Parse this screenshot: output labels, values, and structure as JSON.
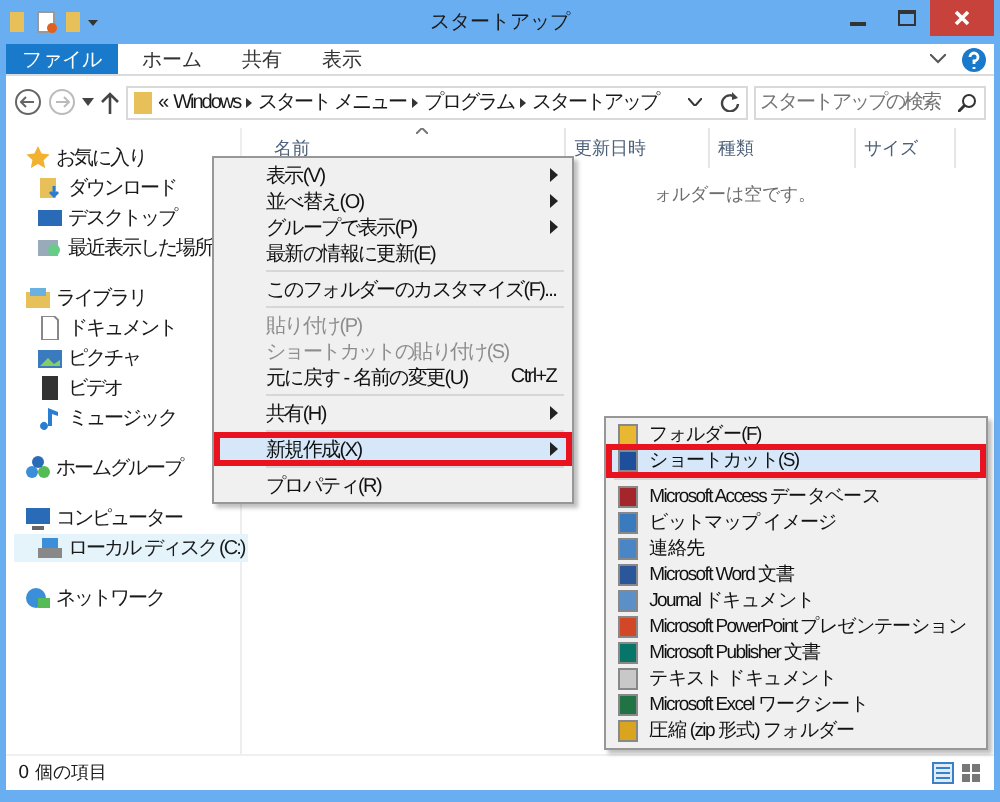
{
  "window": {
    "title": "スタートアップ"
  },
  "ribbon": {
    "tabs": [
      {
        "label": "ファイル",
        "selected": true
      },
      {
        "label": "ホーム",
        "selected": false
      },
      {
        "label": "共有",
        "selected": false
      },
      {
        "label": "表示",
        "selected": false
      }
    ]
  },
  "address_bar": {
    "segments": [
      "«",
      "Windows",
      "スタート メニュー",
      "プログラム",
      "スタートアップ"
    ],
    "search": {
      "placeholder": "スタートアップの検索"
    }
  },
  "navigation": [
    {
      "label": "お気に入り",
      "children": [
        {
          "label": "ダウンロード",
          "selected": false
        },
        {
          "label": "デスクトップ",
          "selected": false
        },
        {
          "label": "最近表示した場所",
          "selected": false
        }
      ]
    },
    {
      "label": "ライブラリ",
      "children": [
        {
          "label": "ドキュメント",
          "selected": false
        },
        {
          "label": "ピクチャ",
          "selected": false
        },
        {
          "label": "ビデオ",
          "selected": false
        },
        {
          "label": "ミュージック",
          "selected": false
        }
      ]
    },
    {
      "label": "ホームグループ"
    },
    {
      "label": "コンピューター",
      "children": [
        {
          "label": "ローカル ディスク (C:)",
          "selected": true
        }
      ]
    },
    {
      "label": "ネットワーク"
    }
  ],
  "columns": [
    {
      "label": "名前",
      "sorted": true
    },
    {
      "label": "更新日時",
      "sorted": false
    },
    {
      "label": "種類",
      "sorted": false
    },
    {
      "label": "サイズ",
      "sorted": false
    }
  ],
  "empty_message": "ォルダーは空です。",
  "context_menu": [
    {
      "kind": "item",
      "label": "表示(V)",
      "submenu": true,
      "disabled": false,
      "highlighted": false
    },
    {
      "kind": "item",
      "label": "並べ替え(O)",
      "submenu": true,
      "disabled": false,
      "highlighted": false
    },
    {
      "kind": "item",
      "label": "グループで表示(P)",
      "submenu": true,
      "disabled": false,
      "highlighted": false
    },
    {
      "kind": "item",
      "label": "最新の情報に更新(E)",
      "submenu": false,
      "disabled": false,
      "highlighted": false
    },
    {
      "kind": "separator"
    },
    {
      "kind": "item",
      "label": "このフォルダーのカスタマイズ(F)...",
      "submenu": false,
      "disabled": false,
      "highlighted": false
    },
    {
      "kind": "separator"
    },
    {
      "kind": "item",
      "label": "貼り付け(P)",
      "submenu": false,
      "disabled": true,
      "highlighted": false
    },
    {
      "kind": "item",
      "label": "ショートカットの貼り付け(S)",
      "submenu": false,
      "disabled": true,
      "highlighted": false
    },
    {
      "kind": "item",
      "label": "元に戻す - 名前の変更(U)",
      "shortcut": "Ctrl+Z",
      "submenu": false,
      "disabled": false,
      "highlighted": false
    },
    {
      "kind": "separator"
    },
    {
      "kind": "item",
      "label": "共有(H)",
      "submenu": true,
      "disabled": false,
      "highlighted": false
    },
    {
      "kind": "separator"
    },
    {
      "kind": "item",
      "label": "新規作成(X)",
      "submenu": true,
      "disabled": false,
      "highlighted": true
    },
    {
      "kind": "separator"
    },
    {
      "kind": "item",
      "label": "プロパティ(R)",
      "submenu": false,
      "disabled": false,
      "highlighted": false
    }
  ],
  "new_submenu": [
    {
      "kind": "item",
      "label": "フォルダー(F)",
      "color": "#e8b830",
      "highlighted": false
    },
    {
      "kind": "item",
      "label": "ショートカット(S)",
      "color": "#1d4f9c",
      "highlighted": true
    },
    {
      "kind": "separator"
    },
    {
      "kind": "item",
      "label": "Microsoft Access データベース",
      "color": "#a4262c",
      "highlighted": false
    },
    {
      "kind": "item",
      "label": "ビットマップ イメージ",
      "color": "#3a7bbf",
      "highlighted": false
    },
    {
      "kind": "item",
      "label": "連絡先",
      "color": "#4a86c5",
      "highlighted": false
    },
    {
      "kind": "item",
      "label": "Microsoft Word 文書",
      "color": "#2b579a",
      "highlighted": false
    },
    {
      "kind": "item",
      "label": "Journal ドキュメント",
      "color": "#5a8fc8",
      "highlighted": false
    },
    {
      "kind": "item",
      "label": "Microsoft PowerPoint プレゼンテーション",
      "color": "#d24726",
      "highlighted": false
    },
    {
      "kind": "item",
      "label": "Microsoft Publisher 文書",
      "color": "#077568",
      "highlighted": false
    },
    {
      "kind": "item",
      "label": "テキスト ドキュメント",
      "color": "#c8c8c8",
      "highlighted": false
    },
    {
      "kind": "item",
      "label": "Microsoft Excel ワークシート",
      "color": "#217346",
      "highlighted": false
    },
    {
      "kind": "item",
      "label": "圧縮 (zip 形式) フォルダー",
      "color": "#d9a520",
      "highlighted": false
    }
  ],
  "status_bar": {
    "text": "0 個の項目"
  }
}
